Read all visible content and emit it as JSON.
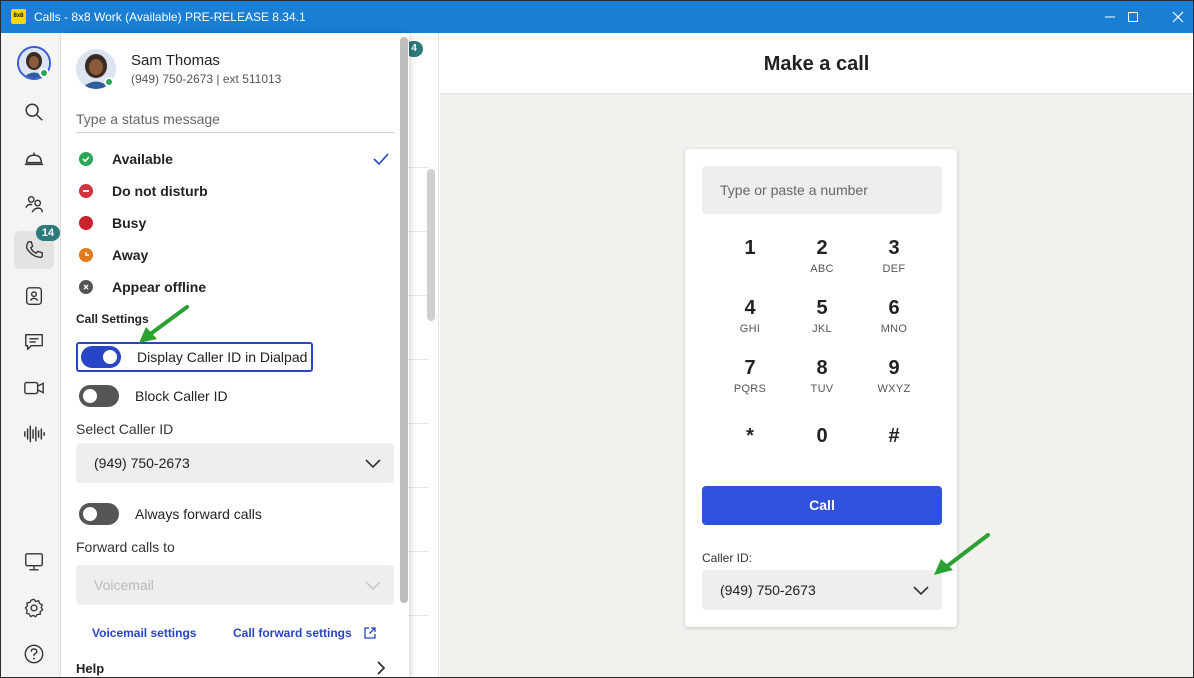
{
  "window": {
    "app_icon_text": "8x8",
    "title": "Calls - 8x8 Work (Available) PRE-RELEASE 8.34.1"
  },
  "rail": {
    "calls_badge": "14",
    "items": [
      "search-icon",
      "lobby-bell-icon",
      "team-icon",
      "phone-icon",
      "contacts-icon",
      "chat-icon",
      "video-icon",
      "voice-wave-icon",
      "computer-icon",
      "gear-icon",
      "help-icon"
    ]
  },
  "list": {
    "badge": "4"
  },
  "status_panel": {
    "user_name": "Sam Thomas",
    "user_phone": "(949) 750-2673 | ext 511013",
    "status_placeholder": "Type a status message",
    "statuses": [
      {
        "label": "Available",
        "color": "#2aa655",
        "selected": true
      },
      {
        "label": "Do not disturb",
        "color": "#d1343f"
      },
      {
        "label": "Busy",
        "color": "#c9232d"
      },
      {
        "label": "Away",
        "color": "#e07a1f"
      },
      {
        "label": "Appear offline",
        "color": "#555555"
      }
    ],
    "call_settings_title": "Call Settings",
    "display_caller_id_label": "Display Caller ID in Dialpad",
    "display_caller_id_on": true,
    "block_caller_id_label": "Block Caller ID",
    "block_caller_id_on": false,
    "select_caller_id_label": "Select Caller ID",
    "select_caller_id_value": "(949) 750-2673",
    "always_forward_label": "Always forward calls",
    "always_forward_on": false,
    "forward_to_label": "Forward calls to",
    "forward_to_value": "Voicemail",
    "voicemail_settings_link": "Voicemail settings",
    "call_forward_settings_link": "Call forward settings",
    "help_label": "Help"
  },
  "dialer": {
    "title": "Make a call",
    "number_placeholder": "Type or paste a number",
    "keys": [
      {
        "digit": "1",
        "letters": ""
      },
      {
        "digit": "2",
        "letters": "ABC"
      },
      {
        "digit": "3",
        "letters": "DEF"
      },
      {
        "digit": "4",
        "letters": "GHI"
      },
      {
        "digit": "5",
        "letters": "JKL"
      },
      {
        "digit": "6",
        "letters": "MNO"
      },
      {
        "digit": "7",
        "letters": "PQRS"
      },
      {
        "digit": "8",
        "letters": "TUV"
      },
      {
        "digit": "9",
        "letters": "WXYZ"
      },
      {
        "digit": "*",
        "letters": ""
      },
      {
        "digit": "0",
        "letters": ""
      },
      {
        "digit": "#",
        "letters": ""
      }
    ],
    "call_button": "Call",
    "caller_id_label": "Caller ID:",
    "caller_id_value": "(949) 750-2673"
  },
  "colors": {
    "titlebar": "#1a7fd4",
    "accent": "#2e52dc",
    "annotation_arrow": "#2aa132"
  }
}
